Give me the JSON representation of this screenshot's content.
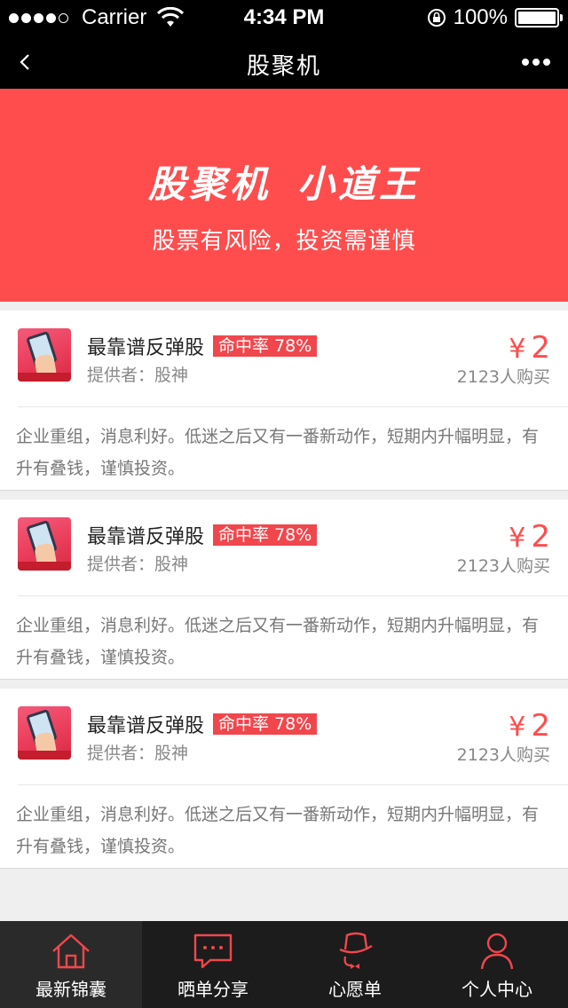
{
  "status": {
    "carrier": "Carrier",
    "time": "4:34 PM",
    "battery": "100%"
  },
  "nav": {
    "title": "股聚机"
  },
  "banner": {
    "title_left": "股聚机",
    "title_right": "小道王",
    "subtitle": "股票有风险，投资需谨慎"
  },
  "products": [
    {
      "name": "最靠谱反弹股",
      "hit_rate": "命中率 78%",
      "provider": "提供者：股神",
      "currency": "¥",
      "price": "2",
      "buyers": "2123人购买",
      "description": "企业重组，消息利好。低迷之后又有一番新动作，短期内升幅明显，有升有叠钱，谨慎投资。"
    },
    {
      "name": "最靠谱反弹股",
      "hit_rate": "命中率 78%",
      "provider": "提供者：股神",
      "currency": "¥",
      "price": "2",
      "buyers": "2123人购买",
      "description": "企业重组，消息利好。低迷之后又有一番新动作，短期内升幅明显，有升有叠钱，谨慎投资。"
    },
    {
      "name": "最靠谱反弹股",
      "hit_rate": "命中率 78%",
      "provider": "提供者：股神",
      "currency": "¥",
      "price": "2",
      "buyers": "2123人购买",
      "description": "企业重组，消息利好。低迷之后又有一番新动作，短期内升幅明显，有升有叠钱，谨慎投资。"
    }
  ],
  "tabs": [
    {
      "label": "最新锦囊",
      "icon": "home-icon",
      "active": true
    },
    {
      "label": "晒单分享",
      "icon": "chat-bubble-icon",
      "active": false
    },
    {
      "label": "心愿单",
      "icon": "gentleman-hat-icon",
      "active": false
    },
    {
      "label": "个人中心",
      "icon": "person-icon",
      "active": false
    }
  ],
  "colors": {
    "accent": "#ff4d4d",
    "tab_icon": "#f0474d",
    "bar_bg": "#000000",
    "tabbar_bg": "#1c1c1c"
  }
}
